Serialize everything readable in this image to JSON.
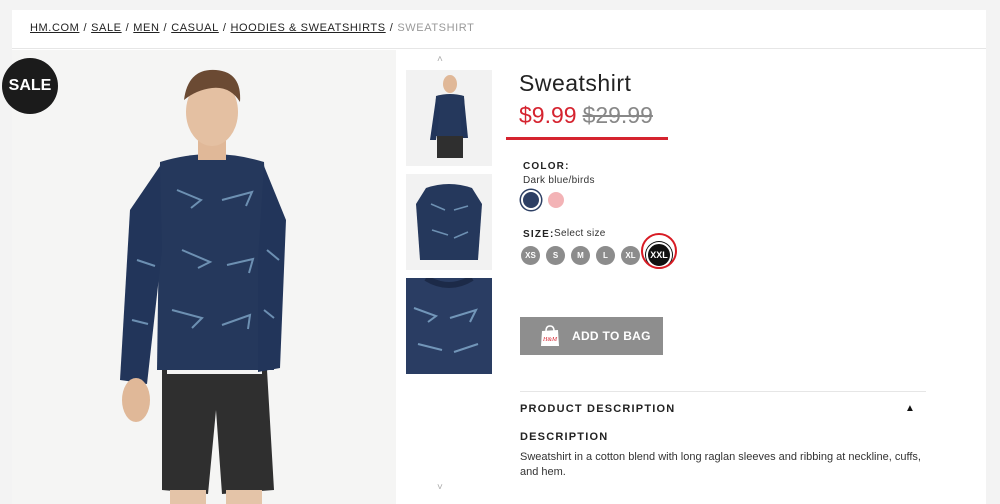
{
  "breadcrumb": {
    "items": [
      "HM.COM",
      "SALE",
      "MEN",
      "CASUAL",
      "HOODIES & SWEATSHIRTS"
    ],
    "current": "SWEATSHIRT",
    "separator": "/"
  },
  "badge": {
    "sale": "SALE"
  },
  "product": {
    "title": "Sweatshirt",
    "sale_price": "$9.99",
    "original_price": "$29.99",
    "color_label": "COLOR:",
    "color_value": "Dark blue/birds",
    "colors": [
      "#2d3f64",
      "#f3b3b6"
    ],
    "size_label": "SIZE:",
    "size_hint": "Select size",
    "sizes": [
      "XS",
      "S",
      "M",
      "L",
      "XL",
      "XXL"
    ],
    "selected_size": "XXL",
    "add_to_bag": "ADD TO BAG",
    "bag_icon_text": "H&M"
  },
  "description": {
    "heading": "PRODUCT DESCRIPTION",
    "toggle_icon": "▲",
    "sub_heading": "DESCRIPTION",
    "text": "Sweatshirt in a cotton blend with long raglan sleeves and ribbing at neckline, cuffs, and hem."
  },
  "thumbnails": {
    "up_arrow": "˄",
    "down_arrow": "˅"
  },
  "icons": {
    "sale_badge": "sale-badge-icon",
    "bag": "shopping-bag-icon",
    "toggle": "chevron-up-icon"
  },
  "accent_colors": {
    "price": "#d5232f",
    "annotation": "#d81b24",
    "button": "#8e8e8e"
  }
}
